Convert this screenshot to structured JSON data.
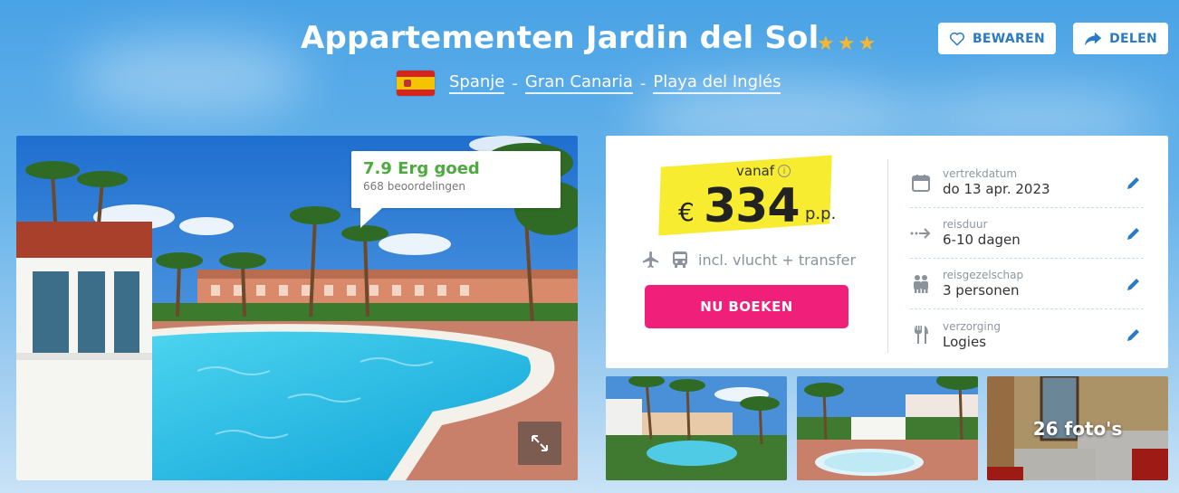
{
  "hotel": {
    "name": "Appartementen Jardin del Sol",
    "stars": 3,
    "star_color": "#f5b731"
  },
  "location": {
    "flag": "spain-flag",
    "country": "Spanje",
    "region": "Gran Canaria",
    "city": "Playa del Inglés",
    "separator": "-"
  },
  "actions": {
    "save_label": "BEWAREN",
    "share_label": "DELEN"
  },
  "rating": {
    "score_text": "7.9 Erg goed",
    "count_text": "668 beoordelingen",
    "color": "#4caa3e"
  },
  "pricing": {
    "from_label": "vanaf",
    "currency": "€",
    "amount": "334",
    "per_person": "p.p.",
    "includes": "incl. vlucht + transfer",
    "book_label": "NU BOEKEN",
    "book_color": "#ef1f7a",
    "highlight_color": "#f7ec2f"
  },
  "details": [
    {
      "icon": "calendar-icon",
      "label": "vertrekdatum",
      "value": "do 13 apr. 2023"
    },
    {
      "icon": "arrow-duration-icon",
      "label": "reisduur",
      "value": "6-10 dagen"
    },
    {
      "icon": "people-icon",
      "label": "reisgezelschap",
      "value": "3 personen"
    },
    {
      "icon": "cutlery-icon",
      "label": "verzorging",
      "value": "Logies"
    }
  ],
  "gallery": {
    "more_photos_label": "26 foto's"
  }
}
